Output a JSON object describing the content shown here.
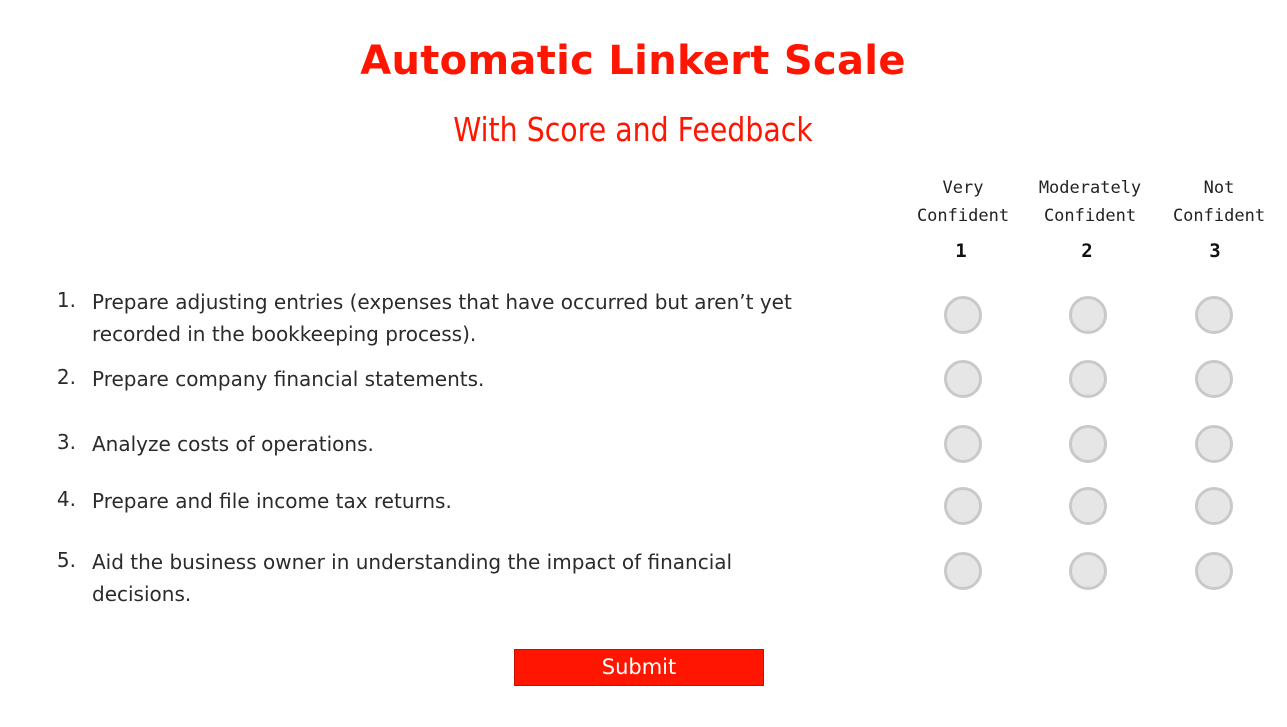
{
  "header": {
    "title": "Automatic Linkert Scale",
    "subtitle": "With Score and Feedback"
  },
  "scale": {
    "columns": [
      {
        "label_line1": "Very",
        "label_line2": "Confident",
        "number": "1"
      },
      {
        "label_line1": "Moderately",
        "label_line2": "Confident",
        "number": "2"
      },
      {
        "label_line1": "Not",
        "label_line2": "Confident",
        "number": "3"
      }
    ]
  },
  "questions": [
    {
      "number": "1.",
      "text": "Prepare adjusting entries (expenses that have occurred but aren’t yet recorded in the bookkeeping process).",
      "selected": null
    },
    {
      "number": "2.",
      "text": "Prepare company financial statements.",
      "selected": null
    },
    {
      "number": "3.",
      "text": "Analyze costs of operations.",
      "selected": null
    },
    {
      "number": "4.",
      "text": "Prepare and file income tax returns.",
      "selected": null
    },
    {
      "number": "5.",
      "text": "Aid the business owner in understanding the impact of financial decisions.",
      "selected": null
    }
  ],
  "actions": {
    "submit_label": "Submit"
  },
  "colors": {
    "accent": "#ff1500",
    "radio_fill": "#e6e6e6",
    "radio_border": "#c9c9c9"
  }
}
